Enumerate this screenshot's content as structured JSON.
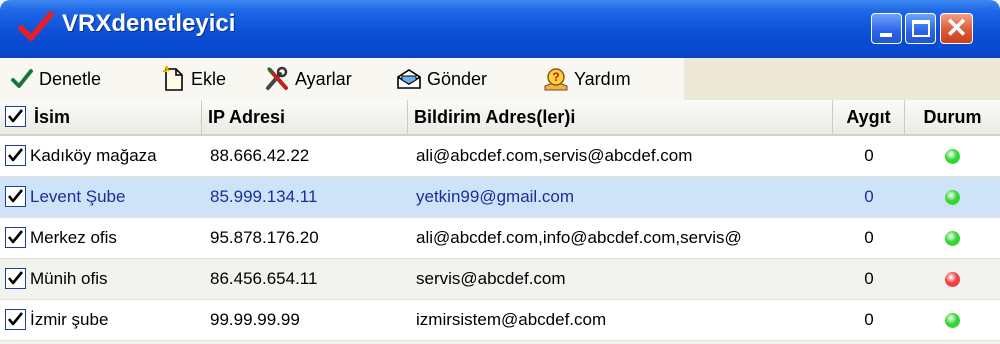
{
  "window": {
    "title": "VRXdenetleyici",
    "controls": [
      "minimize",
      "maximize",
      "close"
    ]
  },
  "toolbar": {
    "items": [
      {
        "label": "Denetle",
        "icon": "checkmark-icon"
      },
      {
        "label": "Ekle",
        "icon": "new-document-icon"
      },
      {
        "label": "Ayarlar",
        "icon": "tools-icon"
      },
      {
        "label": "Gönder",
        "icon": "envelope-icon"
      },
      {
        "label": "Yardım",
        "icon": "help-icon"
      }
    ]
  },
  "grid": {
    "columns": [
      "İsim",
      "IP Adresi",
      "Bildirim Adres(ler)i",
      "Aygıt",
      "Durum"
    ],
    "header_checked": true,
    "rows": [
      {
        "checked": true,
        "name": "Kadıköy mağaza",
        "ip": "88.666.42.22",
        "emails": "ali@abcdef.com,servis@abcdef.com",
        "aygit": "0",
        "status": "green"
      },
      {
        "checked": true,
        "name": "Levent Şube",
        "ip": "85.999.134.11",
        "emails": "yetkin99@gmail.com",
        "aygit": "0",
        "status": "green"
      },
      {
        "checked": true,
        "name": "Merkez ofis",
        "ip": "95.878.176.20",
        "emails": "ali@abcdef.com,info@abcdef.com,servis@",
        "aygit": "0",
        "status": "green"
      },
      {
        "checked": true,
        "name": "Münih ofis",
        "ip": "86.456.654.11",
        "emails": "servis@abcdef.com",
        "aygit": "0",
        "status": "red"
      },
      {
        "checked": true,
        "name": "İzmir şube",
        "ip": "99.99.99.99",
        "emails": "izmirsistem@abcdef.com",
        "aygit": "0",
        "status": "green"
      }
    ]
  },
  "colors": {
    "title_bar": "#0a50d8",
    "selected_row": "#cfe3f8",
    "status_green": "#33d633",
    "status_red": "#f04040"
  }
}
